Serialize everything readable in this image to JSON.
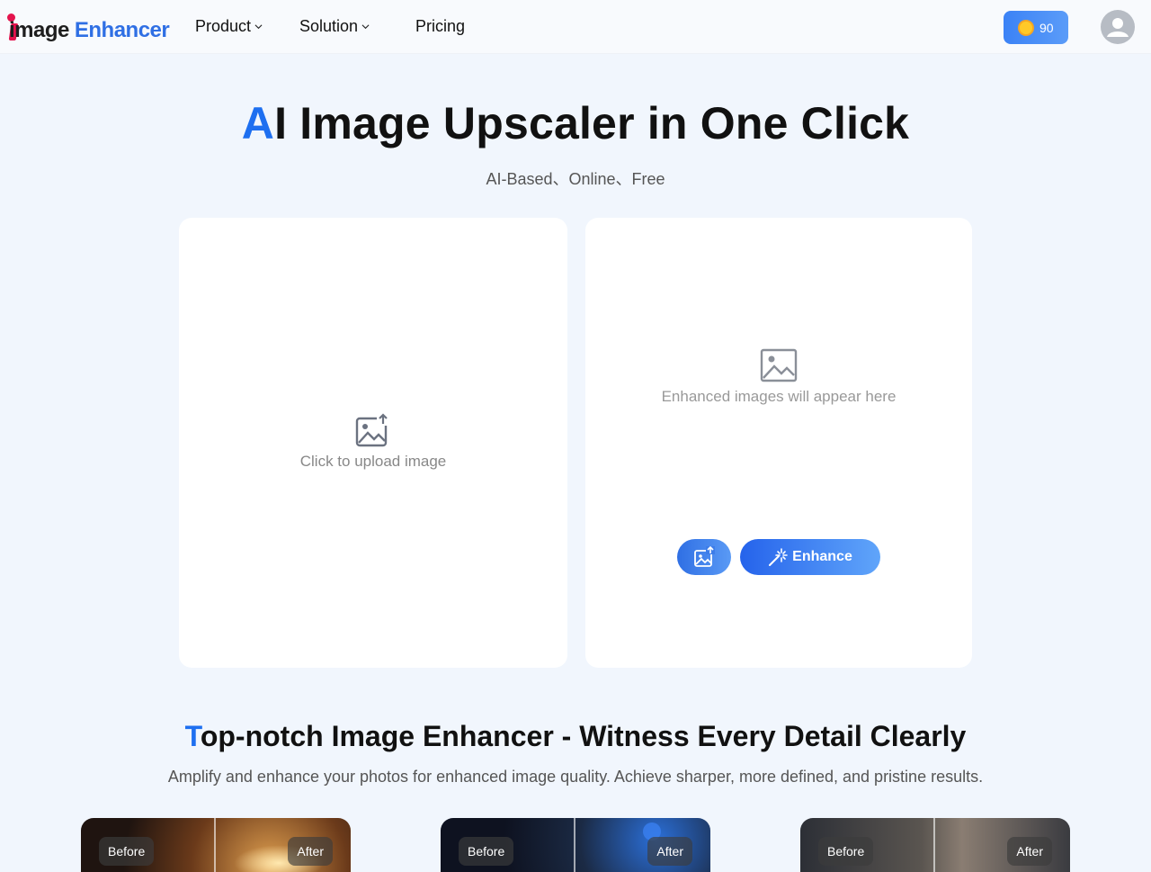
{
  "header": {
    "logo_first": "image",
    "logo_second": "Enhancer",
    "nav": [
      {
        "label": "Product"
      },
      {
        "label": "Solution"
      },
      {
        "label": "Pricing"
      }
    ],
    "credits": "90"
  },
  "hero": {
    "title_accent": "A",
    "title_rest": "I Image Upscaler in One Click",
    "subtitle": "AI-Based、Online、Free"
  },
  "upload_panel": {
    "text": "Click to upload image",
    "icon": "image-upload-icon"
  },
  "result_panel": {
    "text": "Enhanced images will appear here",
    "icon": "image-placeholder-icon",
    "enhance_label": "Enhance"
  },
  "section": {
    "title_accent": "T",
    "title_rest": "op-notch Image Enhancer - Witness Every Detail Clearly",
    "subtitle": "Amplify and enhance your photos for enhanced image quality. Achieve sharper, more defined, and pristine results."
  },
  "examples": [
    {
      "before": "Before",
      "after": "After"
    },
    {
      "before": "Before",
      "after": "After"
    },
    {
      "before": "Before",
      "after": "After"
    }
  ],
  "colors": {
    "accent": "#1e6ff0",
    "logo_red": "#e4134d",
    "button_blue": "#2563eb"
  }
}
